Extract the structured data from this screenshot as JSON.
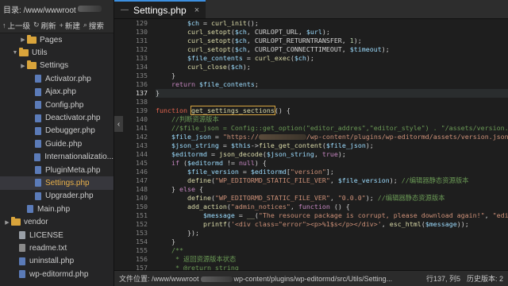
{
  "sidebar": {
    "root_label": "目录:",
    "root_path": "/www/wwwroot",
    "toolbar": [
      {
        "label": "上一级",
        "icon": "arrow-up-icon"
      },
      {
        "label": "刷新",
        "icon": "refresh-icon"
      },
      {
        "label": "新建",
        "icon": "plus-icon"
      },
      {
        "label": "搜索",
        "icon": "search-icon"
      }
    ],
    "tree": [
      {
        "label": "Pages",
        "type": "folder",
        "depth": 2,
        "expanded": false
      },
      {
        "label": "Utils",
        "type": "folder",
        "depth": 1,
        "expanded": true
      },
      {
        "label": "Settings",
        "type": "folder",
        "depth": 2,
        "expanded": false
      },
      {
        "label": "Activator.php",
        "type": "php",
        "depth": 3
      },
      {
        "label": "Ajax.php",
        "type": "php",
        "depth": 3
      },
      {
        "label": "Config.php",
        "type": "php",
        "depth": 3
      },
      {
        "label": "Deactivator.php",
        "type": "php",
        "depth": 3
      },
      {
        "label": "Debugger.php",
        "type": "php",
        "depth": 3
      },
      {
        "label": "Guide.php",
        "type": "php",
        "depth": 3
      },
      {
        "label": "Internationalizatio...",
        "type": "php",
        "depth": 3
      },
      {
        "label": "PluginMeta.php",
        "type": "php",
        "depth": 3
      },
      {
        "label": "Settings.php",
        "type": "php",
        "depth": 3,
        "active": true
      },
      {
        "label": "Upgrader.php",
        "type": "php",
        "depth": 3
      },
      {
        "label": "Main.php",
        "type": "php",
        "depth": 2
      },
      {
        "label": "vendor",
        "type": "folder",
        "depth": 0,
        "expanded": false
      },
      {
        "label": "LICENSE",
        "type": "doc",
        "depth": 1
      },
      {
        "label": "readme.txt",
        "type": "txt",
        "depth": 1
      },
      {
        "label": "uninstall.php",
        "type": "php",
        "depth": 1
      },
      {
        "label": "wp-editormd.php",
        "type": "php",
        "depth": 1
      }
    ]
  },
  "tab": {
    "title": "Settings.php",
    "dash": "—",
    "close": "×"
  },
  "editor": {
    "collapse_glyph": "‹",
    "current_line": 137,
    "lines": [
      {
        "n": 129,
        "t": [
          [
            "pl",
            "        "
          ],
          [
            "var",
            "$ch"
          ],
          [
            "pl",
            " = "
          ],
          [
            "fn",
            "curl_init"
          ],
          [
            "pl",
            "();"
          ]
        ]
      },
      {
        "n": 130,
        "t": [
          [
            "pl",
            "        "
          ],
          [
            "fn",
            "curl_setopt"
          ],
          [
            "pl",
            "("
          ],
          [
            "var",
            "$ch"
          ],
          [
            "pl",
            ", CURLOPT_URL, "
          ],
          [
            "var",
            "$url"
          ],
          [
            "pl",
            ");"
          ]
        ]
      },
      {
        "n": 131,
        "t": [
          [
            "pl",
            "        "
          ],
          [
            "fn",
            "curl_setopt"
          ],
          [
            "pl",
            "("
          ],
          [
            "var",
            "$ch"
          ],
          [
            "pl",
            ", CURLOPT_RETURNTRANSFER, "
          ],
          [
            "num",
            "1"
          ],
          [
            "pl",
            ");"
          ]
        ]
      },
      {
        "n": 132,
        "t": [
          [
            "pl",
            "        "
          ],
          [
            "fn",
            "curl_setopt"
          ],
          [
            "pl",
            "("
          ],
          [
            "var",
            "$ch"
          ],
          [
            "pl",
            ", CURLOPT_CONNECTTIMEOUT, "
          ],
          [
            "var",
            "$timeout"
          ],
          [
            "pl",
            ");"
          ]
        ]
      },
      {
        "n": 133,
        "t": [
          [
            "pl",
            "        "
          ],
          [
            "var",
            "$file_contents"
          ],
          [
            "pl",
            " = "
          ],
          [
            "fn",
            "curl_exec"
          ],
          [
            "pl",
            "("
          ],
          [
            "var",
            "$ch"
          ],
          [
            "pl",
            ");"
          ]
        ]
      },
      {
        "n": 134,
        "t": [
          [
            "pl",
            "        "
          ],
          [
            "fn",
            "curl_close"
          ],
          [
            "pl",
            "("
          ],
          [
            "var",
            "$ch"
          ],
          [
            "pl",
            ");"
          ]
        ]
      },
      {
        "n": 135,
        "t": [
          [
            "pl",
            "    }"
          ]
        ]
      },
      {
        "n": 136,
        "t": [
          [
            "pl",
            "    "
          ],
          [
            "kw",
            "return"
          ],
          [
            "pl",
            " "
          ],
          [
            "var",
            "$file_contents"
          ],
          [
            "pl",
            ";"
          ]
        ]
      },
      {
        "n": 137,
        "t": [
          [
            "pl",
            "}"
          ]
        ]
      },
      {
        "n": 138,
        "t": []
      },
      {
        "n": 139,
        "t": [
          [
            "kwr",
            "function"
          ],
          [
            "pl",
            " "
          ],
          [
            "fnbox",
            "get_settings_sections"
          ],
          [
            "pl",
            "() {"
          ]
        ]
      },
      {
        "n": 140,
        "t": [
          [
            "pl",
            "    "
          ],
          [
            "cm",
            "//判断资源版本"
          ]
        ]
      },
      {
        "n": 141,
        "t": [
          [
            "pl",
            "    "
          ],
          [
            "cm",
            "//$file_json = Config::get_option(\"editor_addres\",\"editor_style\") . \"/assets/version.json\";"
          ]
        ]
      },
      {
        "n": 142,
        "t": [
          [
            "pl",
            "    "
          ],
          [
            "var",
            "$file_json"
          ],
          [
            "pl",
            " = "
          ],
          [
            "str",
            "\"https://"
          ],
          [
            "blur",
            ""
          ],
          [
            "str",
            "/wp-content/plugins/wp-editormd/assets/version.json\""
          ],
          [
            "pl",
            ";"
          ]
        ]
      },
      {
        "n": 143,
        "t": [
          [
            "pl",
            "    "
          ],
          [
            "var",
            "$json_string"
          ],
          [
            "pl",
            " = "
          ],
          [
            "var",
            "$this"
          ],
          [
            "pl",
            "->"
          ],
          [
            "fn",
            "file_get_content"
          ],
          [
            "pl",
            "("
          ],
          [
            "var",
            "$file_json"
          ],
          [
            "pl",
            ");"
          ]
        ]
      },
      {
        "n": 144,
        "t": [
          [
            "pl",
            "    "
          ],
          [
            "var",
            "$editormd"
          ],
          [
            "pl",
            " = "
          ],
          [
            "fn",
            "json_decode"
          ],
          [
            "pl",
            "("
          ],
          [
            "var",
            "$json_string"
          ],
          [
            "pl",
            ", "
          ],
          [
            "kw",
            "true"
          ],
          [
            "pl",
            ");"
          ]
        ]
      },
      {
        "n": 145,
        "t": [
          [
            "pl",
            "    "
          ],
          [
            "kw",
            "if"
          ],
          [
            "pl",
            " ("
          ],
          [
            "var",
            "$editormd"
          ],
          [
            "pl",
            " != "
          ],
          [
            "kw",
            "null"
          ],
          [
            "pl",
            ") {"
          ]
        ]
      },
      {
        "n": 146,
        "t": [
          [
            "pl",
            "        "
          ],
          [
            "var",
            "$file_version"
          ],
          [
            "pl",
            " = "
          ],
          [
            "var",
            "$editormd"
          ],
          [
            "pl",
            "["
          ],
          [
            "str",
            "\"version\""
          ],
          [
            "pl",
            "];"
          ]
        ]
      },
      {
        "n": 147,
        "t": [
          [
            "pl",
            "        "
          ],
          [
            "fn",
            "define"
          ],
          [
            "pl",
            "("
          ],
          [
            "str",
            "\"WP_EDITORMD_STATIC_FILE_VER\""
          ],
          [
            "pl",
            ", "
          ],
          [
            "var",
            "$file_version"
          ],
          [
            "pl",
            "); "
          ],
          [
            "cm",
            "//编辑器静态资源版本"
          ]
        ]
      },
      {
        "n": 148,
        "t": [
          [
            "pl",
            "    } "
          ],
          [
            "kw",
            "else"
          ],
          [
            "pl",
            " {"
          ]
        ]
      },
      {
        "n": 149,
        "t": [
          [
            "pl",
            "        "
          ],
          [
            "fn",
            "define"
          ],
          [
            "pl",
            "("
          ],
          [
            "str",
            "\"WP_EDITORMD_STATIC_FILE_VER\""
          ],
          [
            "pl",
            ", "
          ],
          [
            "str",
            "\"0.0.0\""
          ],
          [
            "pl",
            "); "
          ],
          [
            "cm",
            "//编辑器静态资源版本"
          ]
        ]
      },
      {
        "n": 150,
        "t": [
          [
            "pl",
            "        "
          ],
          [
            "fn",
            "add_action"
          ],
          [
            "pl",
            "("
          ],
          [
            "str",
            "\"admin_notices\""
          ],
          [
            "pl",
            ", "
          ],
          [
            "kw",
            "function"
          ],
          [
            "pl",
            " () {"
          ]
        ]
      },
      {
        "n": 151,
        "t": [
          [
            "pl",
            "            "
          ],
          [
            "var",
            "$message"
          ],
          [
            "pl",
            " = "
          ],
          [
            "fn",
            "__"
          ],
          [
            "pl",
            "("
          ],
          [
            "str",
            "\"The resource package is corrupt, please download again!\""
          ],
          [
            "pl",
            ", "
          ],
          [
            "str",
            "\"editormd\""
          ],
          [
            "pl",
            ");"
          ]
        ]
      },
      {
        "n": 152,
        "t": [
          [
            "pl",
            "            "
          ],
          [
            "fn",
            "printf"
          ],
          [
            "pl",
            "("
          ],
          [
            "str",
            "'<div class=\"error\"><p>%1$s</p></div>'"
          ],
          [
            "pl",
            ", "
          ],
          [
            "fn",
            "esc_html"
          ],
          [
            "pl",
            "("
          ],
          [
            "var",
            "$message"
          ],
          [
            "pl",
            "));"
          ]
        ]
      },
      {
        "n": 153,
        "t": [
          [
            "pl",
            "        });"
          ]
        ]
      },
      {
        "n": 154,
        "t": [
          [
            "pl",
            "    }"
          ]
        ]
      },
      {
        "n": 155,
        "t": [
          [
            "pl",
            "    "
          ],
          [
            "cm",
            "/**"
          ]
        ]
      },
      {
        "n": 156,
        "t": [
          [
            "pl",
            "     "
          ],
          [
            "cm",
            "* 返回资源版本状态"
          ]
        ]
      },
      {
        "n": 157,
        "t": [
          [
            "pl",
            "     "
          ],
          [
            "cm",
            "* @return string"
          ]
        ]
      }
    ]
  },
  "statusbar": {
    "label": "文件位置:",
    "path_start": "/www/wwwroot",
    "path_end": "wp-content/plugins/wp-editormd/src/Utils/Setting...",
    "cursor": "行137, 列5",
    "history": "历史版本: 2"
  },
  "colors": {
    "accent": "#3c8fe0",
    "active_file": "#e8b04a",
    "folder": "#d9a43b"
  }
}
